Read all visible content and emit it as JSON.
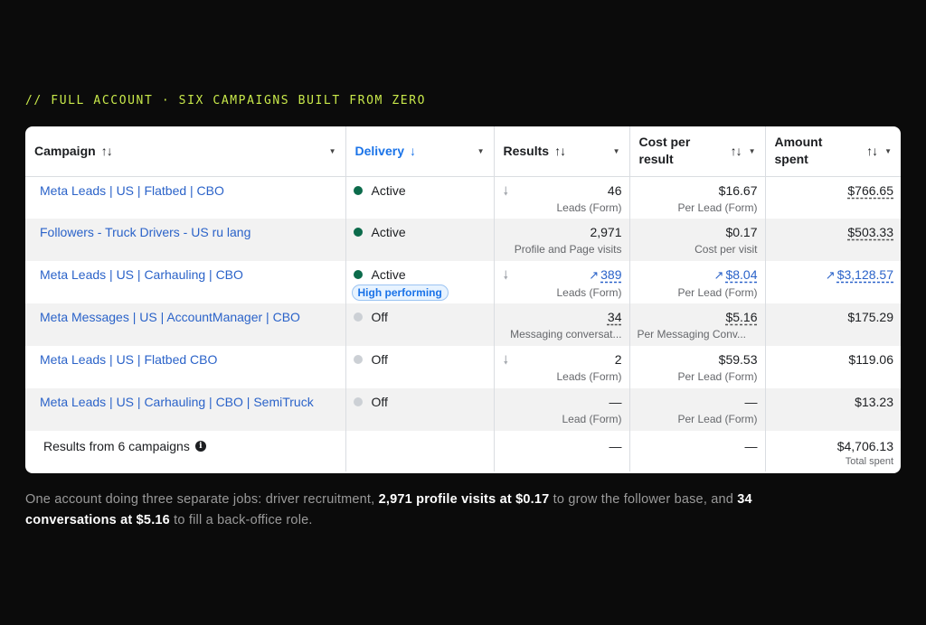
{
  "eyebrow": "// FULL ACCOUNT  ·  SIX CAMPAIGNS BUILT FROM ZERO",
  "headers": {
    "campaign": "Campaign",
    "delivery": "Delivery",
    "results": "Results",
    "cost_per_result": "Cost per result",
    "amount_spent": "Amount spent"
  },
  "rows": [
    {
      "campaign": "Meta Leads | US | Flatbed | CBO",
      "delivery": "Active",
      "results": "46",
      "results_sub": "Leads (Form)",
      "cost": "$16.67",
      "cost_sub": "Per Lead (Form)",
      "spent": "$766.65"
    },
    {
      "campaign": "Followers - Truck Drivers - US ru lang",
      "delivery": "Active",
      "results": "2,971",
      "results_sub": "Profile and Page visits",
      "cost": "$0.17",
      "cost_sub": "Cost per visit",
      "spent": "$503.33"
    },
    {
      "campaign": "Meta Leads | US | Carhauling | CBO",
      "delivery": "Active",
      "badge": "High performing",
      "results": "389",
      "results_sub": "Leads (Form)",
      "cost": "$8.04",
      "cost_sub": "Per Lead (Form)",
      "spent": "$3,128.57"
    },
    {
      "campaign": "Meta Messages | US | AccountManager | CBO",
      "delivery": "Off",
      "results": "34",
      "results_sub": "Messaging conversat...",
      "cost": "$5.16",
      "cost_sub": "Per Messaging Conv...",
      "spent": "$175.29"
    },
    {
      "campaign": "Meta Leads | US | Flatbed CBO",
      "delivery": "Off",
      "results": "2",
      "results_sub": "Leads (Form)",
      "cost": "$59.53",
      "cost_sub": "Per Lead (Form)",
      "spent": "$119.06"
    },
    {
      "campaign": "Meta Leads | US | Carhauling | CBO | SemiTruck",
      "delivery": "Off",
      "results": "—",
      "results_sub": "Lead (Form)",
      "cost": "—",
      "cost_sub": "Per Lead (Form)",
      "spent": "$13.23"
    }
  ],
  "totals": {
    "label": "Results from 6 campaigns",
    "results": "—",
    "cost": "—",
    "spent": "$4,706.13",
    "spent_sub": "Total spent"
  },
  "caption": {
    "p1": "One account doing three separate jobs: driver recruitment, ",
    "b1": "2,971 profile visits at $0.17",
    "p2": " to grow the follower base, and ",
    "b2": "34 conversations at $5.16",
    "p3": " to fill a back-office role."
  },
  "colors": {
    "accent_eyebrow": "#c8e84a",
    "link_blue": "#2b63c9",
    "active_green": "#0c6b4b",
    "off_grey": "#ccd0d5"
  }
}
